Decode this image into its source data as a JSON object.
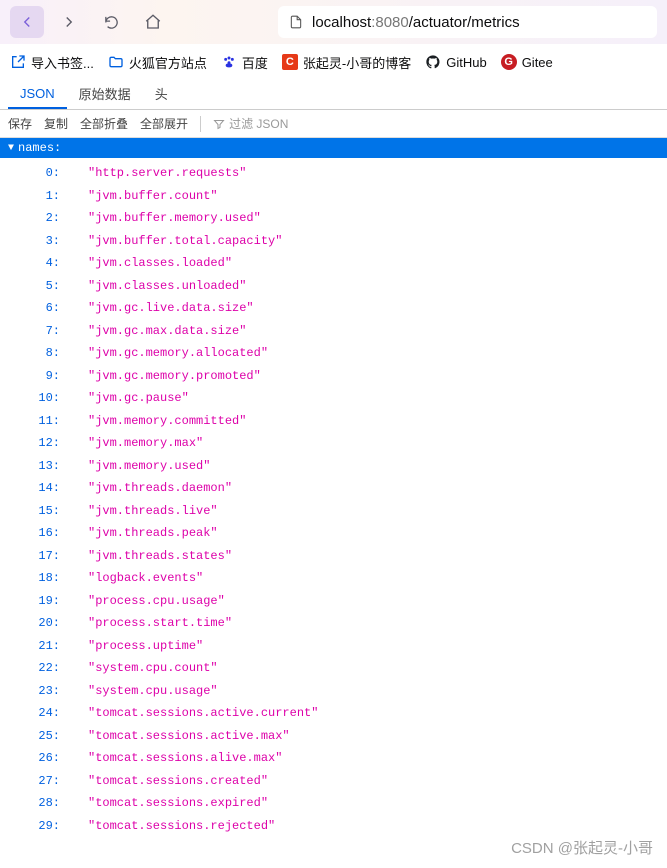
{
  "url": {
    "host": "localhost",
    "port": ":8080",
    "path": "/actuator/metrics"
  },
  "bookmarks": [
    {
      "label": "导入书签...",
      "icon": "import"
    },
    {
      "label": "火狐官方站点",
      "icon": "folder"
    },
    {
      "label": "百度",
      "icon": "baidu"
    },
    {
      "label": "张起灵-小哥的博客",
      "icon": "c-red"
    },
    {
      "label": "GitHub",
      "icon": "github"
    },
    {
      "label": "Gitee",
      "icon": "gitee"
    }
  ],
  "tabs": [
    {
      "label": "JSON",
      "active": true
    },
    {
      "label": "原始数据",
      "active": false
    },
    {
      "label": "头",
      "active": false
    }
  ],
  "toolbar": {
    "save": "保存",
    "copy": "复制",
    "collapse_all": "全部折叠",
    "expand_all": "全部展开",
    "filter_placeholder": "过滤 JSON"
  },
  "json": {
    "key": "names",
    "items": [
      "http.server.requests",
      "jvm.buffer.count",
      "jvm.buffer.memory.used",
      "jvm.buffer.total.capacity",
      "jvm.classes.loaded",
      "jvm.classes.unloaded",
      "jvm.gc.live.data.size",
      "jvm.gc.max.data.size",
      "jvm.gc.memory.allocated",
      "jvm.gc.memory.promoted",
      "jvm.gc.pause",
      "jvm.memory.committed",
      "jvm.memory.max",
      "jvm.memory.used",
      "jvm.threads.daemon",
      "jvm.threads.live",
      "jvm.threads.peak",
      "jvm.threads.states",
      "logback.events",
      "process.cpu.usage",
      "process.start.time",
      "process.uptime",
      "system.cpu.count",
      "system.cpu.usage",
      "tomcat.sessions.active.current",
      "tomcat.sessions.active.max",
      "tomcat.sessions.alive.max",
      "tomcat.sessions.created",
      "tomcat.sessions.expired",
      "tomcat.sessions.rejected"
    ]
  },
  "watermark": "CSDN @张起灵-小哥"
}
